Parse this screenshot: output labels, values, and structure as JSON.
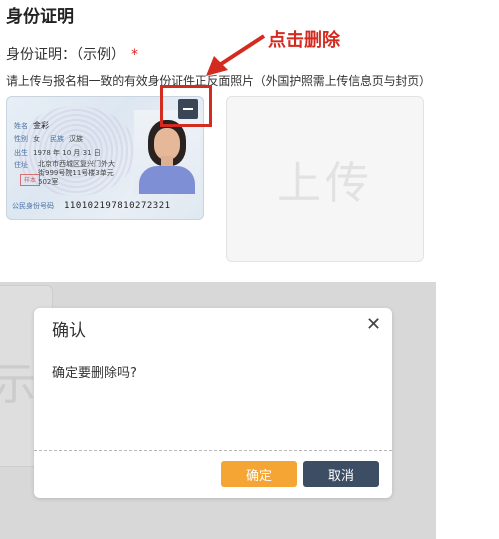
{
  "section": {
    "title": "身份证明"
  },
  "field": {
    "label": "身份证明：（示例）",
    "required_mark": "*"
  },
  "instruction": "请上传与报名相一致的有效身份证件正反面照片（外国护照需上传信息页与封页）",
  "annotation": {
    "label": "点击删除",
    "color": "#d42b20"
  },
  "id_card": {
    "name_key": "姓名",
    "name_value": "金彩",
    "gender_key": "性别",
    "gender_value": "女",
    "ethnicity_key": "民族",
    "ethnicity_value": "汉族",
    "birth_key": "出生",
    "birth_value": "1978  年 10 月 31 日",
    "address_key": "住址",
    "address_lines": [
      "北京市西城区复兴门外大",
      "街999号院11号楼3单元",
      "502室"
    ],
    "id_key": "公民身份号码",
    "id_value": "110102197810272321",
    "stamp_text": "样本"
  },
  "upload": {
    "label": "上传"
  },
  "dialog": {
    "title": "确认",
    "close_icon": "close-icon",
    "message": "确定要删除吗?",
    "confirm_label": "确定",
    "cancel_label": "取消",
    "confirm_color": "#f4a533",
    "cancel_color": "#3d4d63"
  },
  "background": {
    "glyph": "示"
  }
}
